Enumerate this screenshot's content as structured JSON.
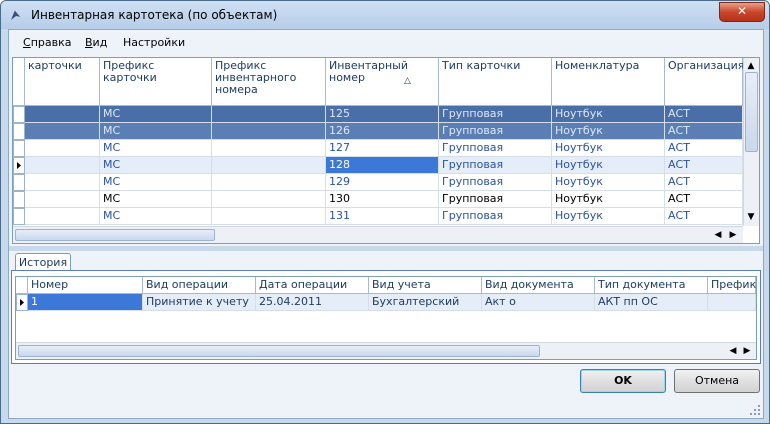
{
  "window": {
    "title": "Инвентарная картотека (по объектам)",
    "close_glyph": "✕"
  },
  "menu": [
    {
      "label": "Справка",
      "accel": "С"
    },
    {
      "label": "Вид",
      "accel": "В"
    },
    {
      "label": "Настройки",
      "accel": ""
    }
  ],
  "top_grid": {
    "columns": [
      "карточки",
      "Префикс карточки",
      "Префикс инвентарного номера",
      "Инвентарный номер",
      "Тип карточки",
      "Номенклатура",
      "Организация"
    ],
    "sort_glyph": "△",
    "rows": [
      [
        "",
        "МС",
        "",
        "125",
        "Групповая",
        "Ноутбук",
        "АСТ"
      ],
      [
        "",
        "МС",
        "",
        "126",
        "Групповая",
        "Ноутбук",
        "АСТ"
      ],
      [
        "",
        "МС",
        "",
        "127",
        "Групповая",
        "Ноутбук",
        "АСТ"
      ],
      [
        "",
        "МС",
        "",
        "128",
        "Групповая",
        "Ноутбук",
        "АСТ"
      ],
      [
        "",
        "МС",
        "",
        "129",
        "Групповая",
        "Ноутбук",
        "АСТ"
      ],
      [
        "",
        "МС",
        "",
        "130",
        "Групповая",
        "Ноутбук",
        "АСТ"
      ],
      [
        "",
        "МС",
        "",
        "131",
        "Групповая",
        "Ноутбук",
        "АСТ"
      ]
    ]
  },
  "tabs": [
    {
      "label": "История"
    }
  ],
  "history_grid": {
    "columns": [
      "Номер",
      "Вид операции",
      "Дата операции",
      "Вид учета",
      "Вид документа",
      "Тип документа",
      "Префикс"
    ],
    "rows": [
      [
        "1",
        "Принятие к учету",
        "25.04.2011",
        "Бухгалтерский",
        "Акт о",
        "АКТ пп ОС",
        ""
      ]
    ]
  },
  "buttons": {
    "ok": "OK",
    "cancel": "Отмена"
  },
  "colors": {
    "selection": "#5b7fb4",
    "focus": "#3c78d8",
    "text_blue": "#2a52a0"
  }
}
